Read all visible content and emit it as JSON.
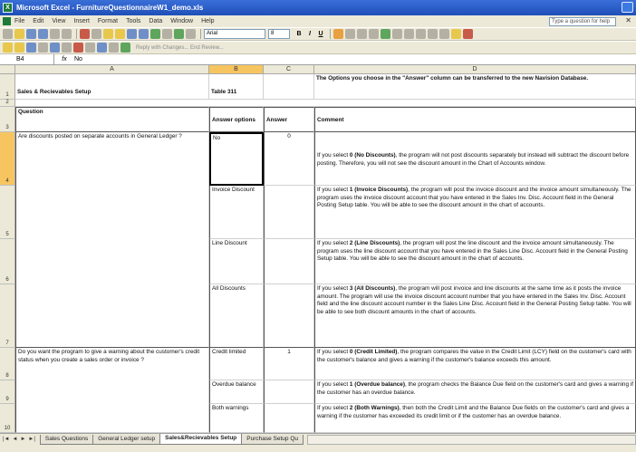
{
  "window": {
    "title": "Microsoft Excel - FurnitureQuestionnaireW1_demo.xls",
    "app_icon": "excel-icon"
  },
  "menu": {
    "items": [
      "File",
      "Edit",
      "View",
      "Insert",
      "Format",
      "Tools",
      "Data",
      "Window",
      "Help"
    ],
    "ask_placeholder": "Type a question for help"
  },
  "toolbar": {
    "font": "Arial",
    "size": "8",
    "bold": "B",
    "italic": "I",
    "underline": "U",
    "reply_text": "Reply with Changes... End Review..."
  },
  "formula_bar": {
    "name_box": "B4",
    "fx": "fx",
    "value": "No"
  },
  "columns": [
    "A",
    "B",
    "C",
    "D"
  ],
  "rows": {
    "r1": {
      "num": "1",
      "a": "Sales & Recievables Setup",
      "b": "Table 311",
      "d": "The Options you choose in the \"Answer\" column can be transferred to the new Navision Database."
    },
    "r2": {
      "num": "2"
    },
    "r3": {
      "num": "3",
      "a": "Question",
      "b": "Answer options",
      "c": "Answer",
      "d": "Comment"
    },
    "r4": {
      "num": "4",
      "a": "Are discounts posted on separate accounts in General Ledger ?",
      "b": "No",
      "c": "0",
      "d_pre": "If you select ",
      "d_bold": "0 (No Discounts)",
      "d_post": ", the program will not post discounts separately but instead will subtract the discount before posting. Therefore, you will not see the discount amount in the Chart of Accounts window."
    },
    "r5": {
      "num": "5",
      "b": "Invoice Discount",
      "d_pre": "If you select ",
      "d_bold": "1 (Invoice Discounts)",
      "d_post": ", the program will post the invoice discount and the invoice amount simultaneously. The program uses the invoice discount account that you have entered in the Sales Inv. Disc. Account field in the General Posting Setup table. You will be able to see the discount amount in the chart of accounts."
    },
    "r6": {
      "num": "6",
      "b": "Line Discount",
      "d_pre": "If you select ",
      "d_bold": "2 (Line Discounts)",
      "d_post": ", the program will post the line discount and the invoice amount simultaneously. The program uses the line discount account that you have entered in the Sales Line Disc. Account field in the General Posting Setup table. You will be able to see the discount amount in the chart of accounts."
    },
    "r7": {
      "num": "7",
      "b": "All Discounts",
      "d_pre": "If you select ",
      "d_bold": "3 (All Discounts)",
      "d_post": ", the program will post invoice and line discounts at the same time as it posts the invoice amount. The program will use the invoice discount account number that you have entered in the Sales Inv. Disc. Account field and the line discount account number in the Sales Line Disc. Account field in the General Posting Setup table. You will be able to see both discount amounts in the chart of accounts."
    },
    "r8": {
      "num": "8",
      "a": "Do you want the program to give a warning about the customer's credit status when you create a sales order or invoice ?",
      "b": "Credit limited",
      "c": "1",
      "d_pre": "If you select ",
      "d_bold": "0 (Credit Limited)",
      "d_post": ", the program compares the value in the Credit Limit (LCY) field on the customer's card with the customer's balance and gives a warning if the customer's balance exceeds this amount."
    },
    "r9": {
      "num": "9",
      "b": "Overdue balance",
      "d_pre": "If you select ",
      "d_bold": "1 (Overdue balance)",
      "d_post": ", the program checks the Balance Due field on the customer's card and gives a warning if the customer has an overdue balance."
    },
    "r10": {
      "num": "10",
      "b": "Both warnings",
      "d_pre": "If you select ",
      "d_bold": "2 (Both Warnings)",
      "d_post": ", then both the Credit Limit and the Balance Due fields on the customer's card and gives a warning if the customer has exceeded its credit limit or if the customer has an overdue balance."
    }
  },
  "sheet_tabs": {
    "nav": [
      "|◄",
      "◄",
      "►",
      "►|"
    ],
    "tabs": [
      "Sales Questions",
      "General Ledger setup",
      "Sales&Recievables Setup",
      "Purchase Setup Qu"
    ],
    "active": 2
  }
}
